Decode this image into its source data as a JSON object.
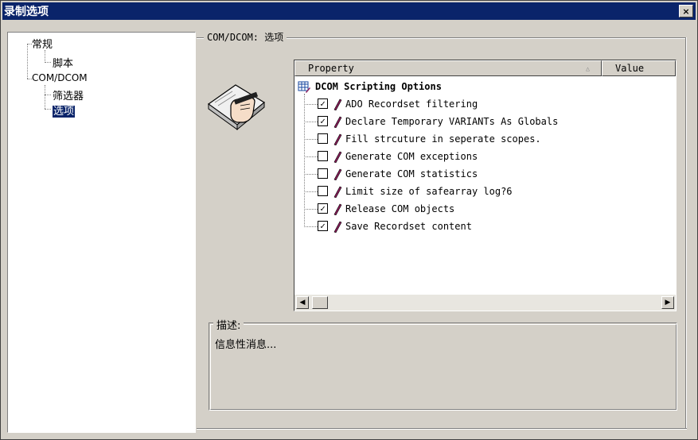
{
  "window": {
    "title": "录制选项",
    "close_glyph": "×"
  },
  "tree": [
    {
      "label": "常规"
    },
    {
      "label": "脚本"
    },
    {
      "label": "COM/DCOM"
    },
    {
      "label": "筛选器"
    },
    {
      "label": "选项",
      "selected": true
    }
  ],
  "group_title": "COM/DCOM: 选项",
  "grid": {
    "columns": [
      "Property",
      "Value"
    ],
    "root": {
      "label": "DCOM Scripting Options"
    },
    "items": [
      {
        "label": "ADO Recordset filtering",
        "checked": true
      },
      {
        "label": "Declare Temporary VARIANTs As Globals",
        "checked": true
      },
      {
        "label": "Fill strcuture in seperate scopes.",
        "checked": false
      },
      {
        "label": "Generate COM exceptions",
        "checked": false
      },
      {
        "label": "Generate COM statistics",
        "checked": false
      },
      {
        "label": "Limit size of safearray log?6",
        "checked": false
      },
      {
        "label": "Release COM objects",
        "checked": true
      },
      {
        "label": "Save Recordset content",
        "checked": true
      }
    ]
  },
  "description": {
    "label": "描述:",
    "text": "信息性消息..."
  },
  "icons": {
    "checkmark": "✓",
    "scroll_left": "◀",
    "scroll_right": "▶",
    "sort": "△"
  },
  "colors": {
    "titlebar": "#0a246a",
    "selection": "#0a246a",
    "face": "#d4d0c8",
    "pen": "#8b1a5a"
  }
}
